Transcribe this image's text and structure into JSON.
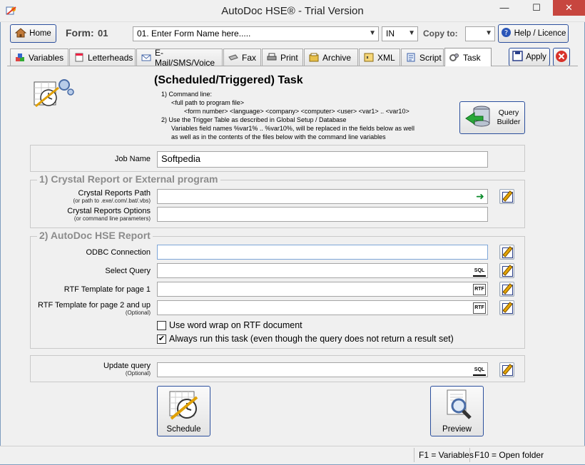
{
  "window": {
    "title": "AutoDoc HSE® - Trial Version",
    "minimize": "—",
    "maximize": "☐",
    "close": "✕"
  },
  "header": {
    "home_label": "Home",
    "form_label": "Form:",
    "form_number": "01",
    "form_name": "01. Enter Form Name here.....",
    "language": "IN",
    "copy_to_label": "Copy to:",
    "copy_to_value": "",
    "help_label": "Help / Licence",
    "apply_label": "Apply"
  },
  "tabs": [
    {
      "label": "Variables"
    },
    {
      "label": "Letterheads"
    },
    {
      "label": "E-Mail/SMS/Voice"
    },
    {
      "label": "Fax"
    },
    {
      "label": "Print"
    },
    {
      "label": "Archive"
    },
    {
      "label": "XML"
    },
    {
      "label": "Script"
    },
    {
      "label": "Task"
    }
  ],
  "task": {
    "title": "(Scheduled/Triggered) Task",
    "info": [
      "1) Command line:",
      "<full path to program file>",
      "<form number> <language> <company> <computer> <user> <var1> .. <var10>",
      "2) Use the Trigger Table as described in Global Setup / Database",
      "Variables field names %var1% .. %var10%, will be replaced in the fields  below as well",
      "as well as in the contents of the files below with the command line variables"
    ],
    "query_builder_label": "Query Builder",
    "job_name_label": "Job Name",
    "job_name_value": "Softpedia"
  },
  "crystal": {
    "group_title": "1) Crystal Report or External program",
    "path_label": "Crystal Reports Path",
    "path_sub": "(or path to .exe/.com/.bat/.vbs)",
    "path_value": "",
    "options_label": "Crystal Reports Options",
    "options_sub": "(or command line parameters)",
    "options_value": ""
  },
  "autodoc": {
    "group_title": "2) AutoDoc HSE Report",
    "odbc_label": "ODBC Connection",
    "odbc_value": "",
    "query_label": "Select Query",
    "query_value": "",
    "rtf1_label": "RTF Template for page 1",
    "rtf1_value": "",
    "rtf2_label": "RTF Template for page 2 and up",
    "rtf2_sub": "(Optional)",
    "rtf2_value": "",
    "wordwrap_label": "Use word wrap on RTF document",
    "wordwrap_checked": false,
    "always_run_label": "Always run this task (even though the query does not return a result set)",
    "always_run_checked": true
  },
  "update": {
    "label": "Update query",
    "sub": "(Optional)",
    "value": ""
  },
  "actions": {
    "schedule_label": "Schedule",
    "preview_label": "Preview"
  },
  "status": {
    "f1": "F1 = Variables",
    "f10": "F10 = Open folder"
  },
  "icons": {
    "in_field_sql": "SQL",
    "in_field_rtf": "RTF",
    "in_field_arrow": "➜"
  }
}
